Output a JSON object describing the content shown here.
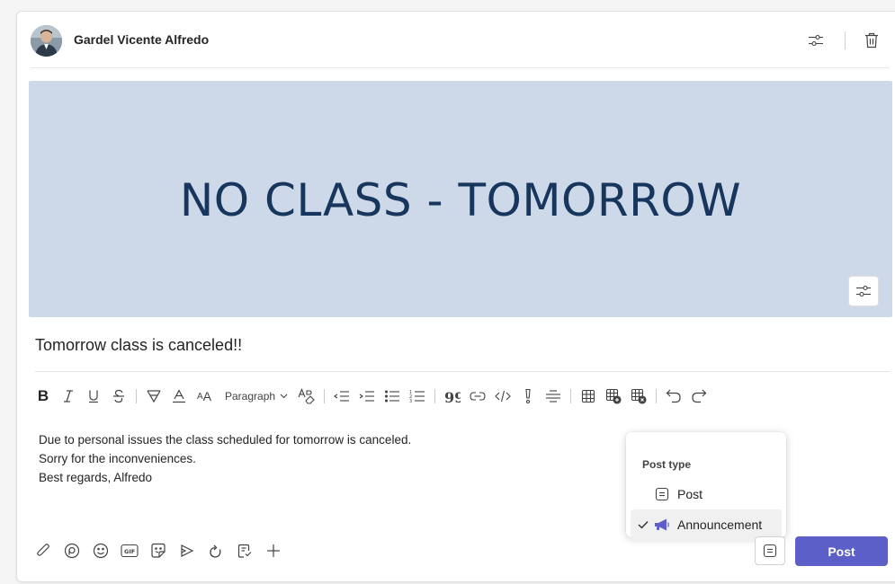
{
  "header": {
    "author_name": "Gardel Vicente Alfredo",
    "avatar": "user-avatar",
    "settings_icon": "sliders-icon",
    "delete_icon": "trash-icon"
  },
  "banner": {
    "text": "NO CLASS - TOMORROW",
    "background": "#cdd9e8",
    "text_color": "#17365d",
    "options_icon": "sliders-icon"
  },
  "subject": "Tomorrow class is canceled!!",
  "toolbar": {
    "paragraph_label": "Paragraph",
    "items": [
      "bold",
      "italic",
      "underline",
      "strikethrough",
      "highlight",
      "font-color",
      "font-size",
      "paragraph",
      "clear-format",
      "decrease-indent",
      "increase-indent",
      "bullet-list",
      "numbered-list",
      "quote",
      "link",
      "code",
      "callout",
      "horizontal-rule",
      "table",
      "table-add",
      "table-delete",
      "undo",
      "redo"
    ],
    "bold_label": "B"
  },
  "body": {
    "lines": [
      "Due to personal issues the class scheduled for tomorrow is canceled.",
      "Sorry for the inconveniences.",
      "Best regards, Alfredo"
    ]
  },
  "post_type_menu": {
    "title": "Post type",
    "options": [
      {
        "label": "Post",
        "icon": "post-icon",
        "selected": false
      },
      {
        "label": "Announcement",
        "icon": "megaphone-icon",
        "selected": true
      }
    ]
  },
  "bottom_toolbar": {
    "items": [
      "attach-icon",
      "loop-icon",
      "emoji-icon",
      "gif-icon",
      "sticker-icon",
      "stream-icon",
      "praise-icon",
      "approvals-icon",
      "plus-icon"
    ]
  },
  "actions": {
    "post_label": "Post",
    "post_color": "#5b5fc7"
  }
}
